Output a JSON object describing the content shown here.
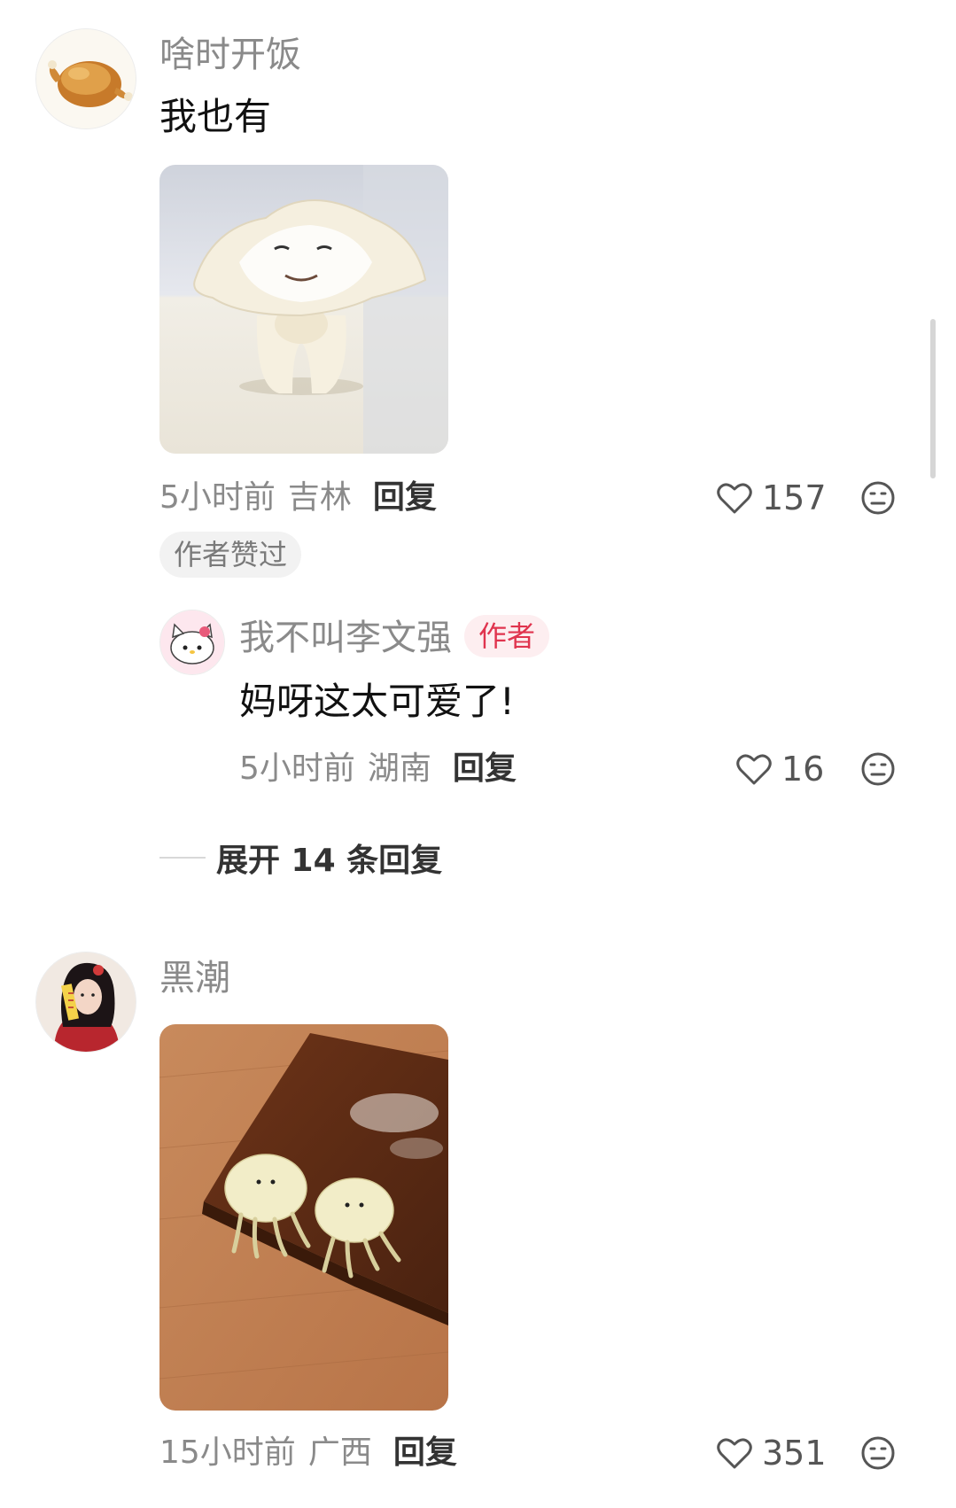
{
  "comments": [
    {
      "username": "啥时开饭",
      "avatar_icon": "roast-chicken-avatar",
      "text": "我也有",
      "photo": "dough-figure-photo",
      "time": "5小时前",
      "location": "吉林",
      "reply_label": "回复",
      "likes": "157",
      "badge": "作者赞过",
      "replies": [
        {
          "username": "我不叫李文强",
          "avatar_icon": "hello-kitty-avatar",
          "author_label": "作者",
          "text": "妈呀这太可爱了!",
          "time": "5小时前",
          "location": "湖南",
          "reply_label": "回复",
          "likes": "16"
        }
      ],
      "expand_label": "展开 14 条回复"
    },
    {
      "username": "黑潮",
      "avatar_icon": "cosplay-girl-avatar",
      "photo": "dumplings-on-board-photo",
      "time": "15小时前",
      "location": "广西",
      "reply_label": "回复",
      "likes": "351"
    }
  ],
  "icons": {
    "like": "heart-icon",
    "emoji": "emoji-icon"
  },
  "colors": {
    "author_badge_text": "#e0344e",
    "author_badge_bg": "#fdeef0",
    "meta_gray": "#8a8a8a"
  }
}
